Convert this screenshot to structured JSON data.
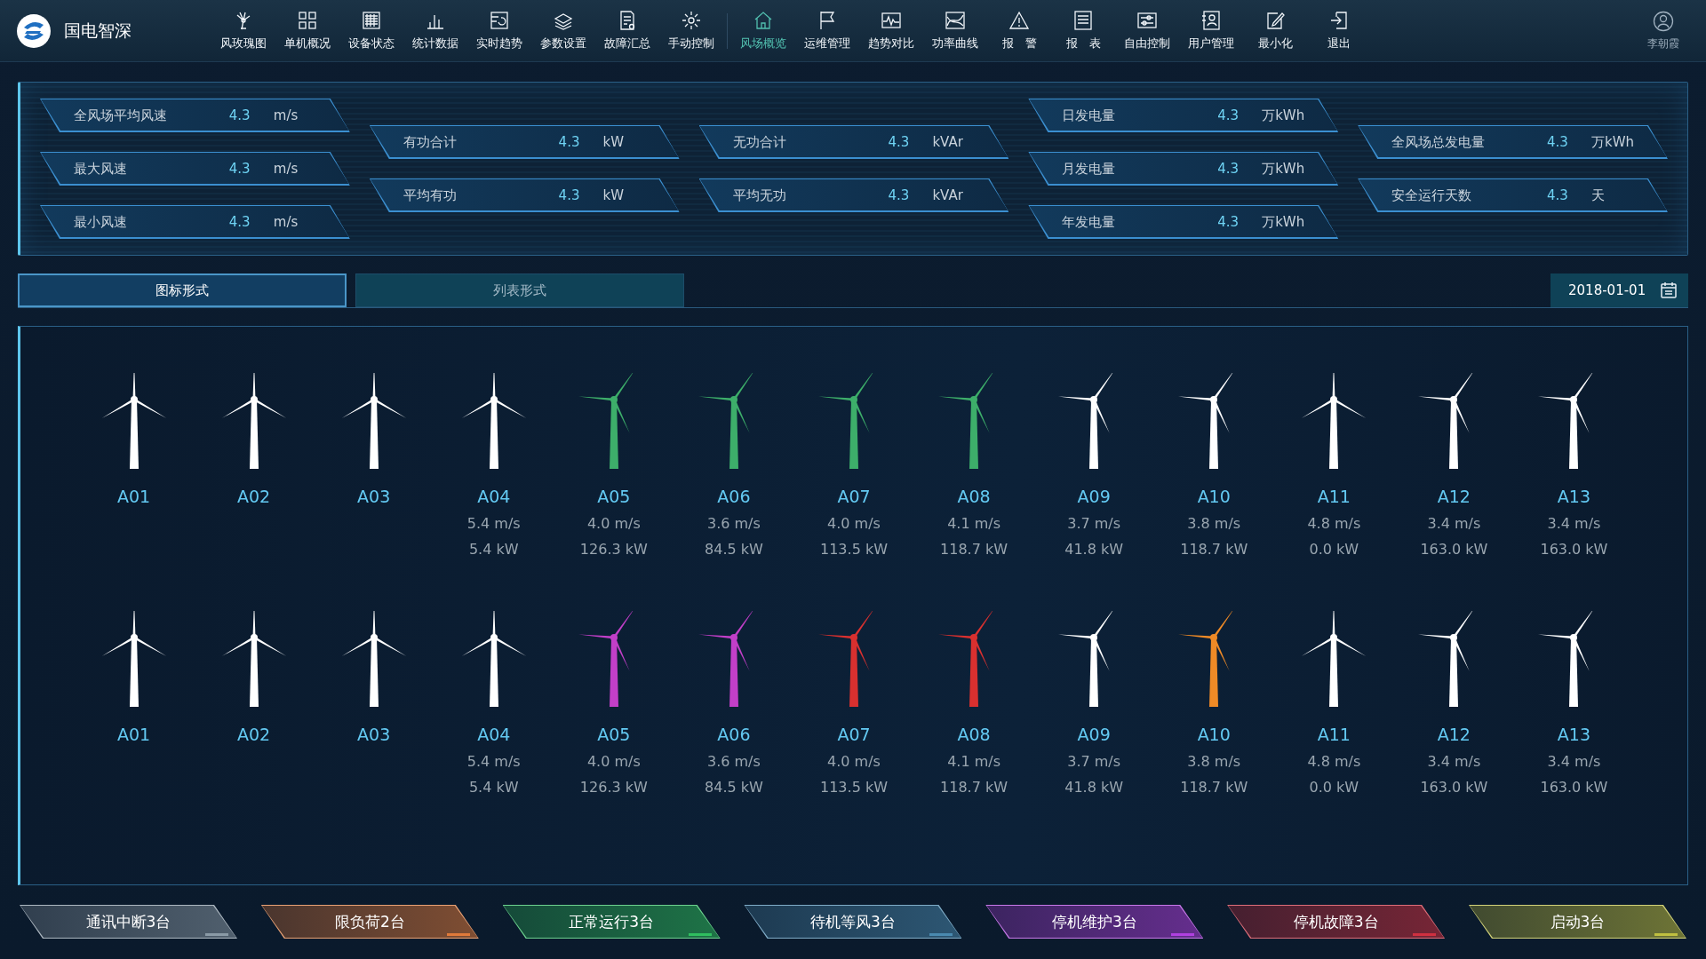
{
  "app": {
    "title": "国电智深",
    "user": "李朝霞"
  },
  "nav": [
    {
      "label": "风玫瑰图",
      "selected": false
    },
    {
      "label": "单机概况",
      "selected": false
    },
    {
      "label": "设备状态",
      "selected": false
    },
    {
      "label": "统计数据",
      "selected": false
    },
    {
      "label": "实时趋势",
      "selected": false
    },
    {
      "label": "参数设置",
      "selected": false
    },
    {
      "label": "故障汇总",
      "selected": false
    },
    {
      "label": "手动控制",
      "selected": false
    },
    {
      "label": "风场概览",
      "selected": true
    },
    {
      "label": "运维管理",
      "selected": false
    },
    {
      "label": "趋势对比",
      "selected": false
    },
    {
      "label": "功率曲线",
      "selected": false
    },
    {
      "label": "报　警",
      "selected": false
    },
    {
      "label": "报　表",
      "selected": false
    },
    {
      "label": "自由控制",
      "selected": false
    },
    {
      "label": "用户管理",
      "selected": false
    },
    {
      "label": "最小化",
      "selected": false
    },
    {
      "label": "退出",
      "selected": false
    }
  ],
  "stats": [
    {
      "items": [
        {
          "label": "全风场平均风速",
          "value": "4.3",
          "unit": "m/s"
        },
        {
          "label": "最大风速",
          "value": "4.3",
          "unit": "m/s"
        },
        {
          "label": "最小风速",
          "value": "4.3",
          "unit": "m/s"
        }
      ]
    },
    {
      "items": [
        {
          "label": "有功合计",
          "value": "4.3",
          "unit": "kW"
        },
        {
          "label": "平均有功",
          "value": "4.3",
          "unit": "kW"
        }
      ]
    },
    {
      "items": [
        {
          "label": "无功合计",
          "value": "4.3",
          "unit": "kVAr"
        },
        {
          "label": "平均无功",
          "value": "4.3",
          "unit": "kVAr"
        }
      ]
    },
    {
      "items": [
        {
          "label": "日发电量",
          "value": "4.3",
          "unit": "万kWh"
        },
        {
          "label": "月发电量",
          "value": "4.3",
          "unit": "万kWh"
        },
        {
          "label": "年发电量",
          "value": "4.3",
          "unit": "万kWh"
        }
      ]
    },
    {
      "items": [
        {
          "label": "全风场总发电量",
          "value": "4.3",
          "unit": "万kWh"
        },
        {
          "label": "安全运行天数",
          "value": "4.3",
          "unit": "天"
        }
      ]
    }
  ],
  "view_tabs": [
    {
      "label": "图标形式",
      "selected": true
    },
    {
      "label": "列表形式",
      "selected": false
    }
  ],
  "date": "2018-01-01",
  "turbine_rows": [
    [
      {
        "name": "A01",
        "kind": "upright",
        "color": "#ffffff"
      },
      {
        "name": "A02",
        "kind": "upright",
        "color": "#ffffff"
      },
      {
        "name": "A03",
        "kind": "upright",
        "color": "#ffffff"
      },
      {
        "name": "A04",
        "kind": "upright",
        "color": "#ffffff",
        "speed": "5.4 m/s",
        "power": "5.4 kW"
      },
      {
        "name": "A05",
        "kind": "turned",
        "color": "#3dae6a",
        "speed": "4.0 m/s",
        "power": "126.3 kW"
      },
      {
        "name": "A06",
        "kind": "turned",
        "color": "#3dae6a",
        "speed": "3.6 m/s",
        "power": "84.5 kW"
      },
      {
        "name": "A07",
        "kind": "turned",
        "color": "#3dae6a",
        "speed": "4.0 m/s",
        "power": "113.5 kW"
      },
      {
        "name": "A08",
        "kind": "turned",
        "color": "#3dae6a",
        "speed": "4.1 m/s",
        "power": "118.7 kW"
      },
      {
        "name": "A09",
        "kind": "turned",
        "color": "#ffffff",
        "speed": "3.7 m/s",
        "power": "41.8 kW"
      },
      {
        "name": "A10",
        "kind": "turned",
        "color": "#ffffff",
        "speed": "3.8 m/s",
        "power": "118.7 kW"
      },
      {
        "name": "A11",
        "kind": "upright",
        "color": "#ffffff",
        "speed": "4.8 m/s",
        "power": "0.0 kW"
      },
      {
        "name": "A12",
        "kind": "turned",
        "color": "#ffffff",
        "speed": "3.4 m/s",
        "power": "163.0 kW"
      },
      {
        "name": "A13",
        "kind": "turned",
        "color": "#ffffff",
        "speed": "3.4 m/s",
        "power": "163.0 kW"
      }
    ],
    [
      {
        "name": "A01",
        "kind": "upright",
        "color": "#ffffff"
      },
      {
        "name": "A02",
        "kind": "upright",
        "color": "#ffffff"
      },
      {
        "name": "A03",
        "kind": "upright",
        "color": "#ffffff"
      },
      {
        "name": "A04",
        "kind": "upright",
        "color": "#ffffff",
        "speed": "5.4 m/s",
        "power": "5.4 kW"
      },
      {
        "name": "A05",
        "kind": "turned",
        "color": "#c23fc8",
        "speed": "4.0 m/s",
        "power": "126.3 kW"
      },
      {
        "name": "A06",
        "kind": "turned",
        "color": "#c23fc8",
        "speed": "3.6 m/s",
        "power": "84.5 kW"
      },
      {
        "name": "A07",
        "kind": "turned",
        "color": "#d9302f",
        "speed": "4.0 m/s",
        "power": "113.5 kW"
      },
      {
        "name": "A08",
        "kind": "turned",
        "color": "#d9302f",
        "speed": "4.1 m/s",
        "power": "118.7 kW"
      },
      {
        "name": "A09",
        "kind": "turned",
        "color": "#ffffff",
        "speed": "3.7 m/s",
        "power": "41.8 kW"
      },
      {
        "name": "A10",
        "kind": "turned",
        "color": "#ef8a26",
        "speed": "3.8 m/s",
        "power": "118.7 kW"
      },
      {
        "name": "A11",
        "kind": "upright",
        "color": "#ffffff",
        "speed": "4.8 m/s",
        "power": "0.0 kW"
      },
      {
        "name": "A12",
        "kind": "turned",
        "color": "#ffffff",
        "speed": "3.4 m/s",
        "power": "163.0 kW"
      },
      {
        "name": "A13",
        "kind": "turned",
        "color": "#ffffff",
        "speed": "3.4 m/s",
        "power": "163.0 kW"
      }
    ]
  ],
  "legend": [
    {
      "label": "通讯中断3台",
      "color": "#8a9aa6"
    },
    {
      "label": "限负荷2台",
      "color": "#e07a3a"
    },
    {
      "label": "正常运行3台",
      "color": "#2fbf5f"
    },
    {
      "label": "待机等风3台",
      "color": "#4a8ab0"
    },
    {
      "label": "停机维护3台",
      "color": "#b040e0"
    },
    {
      "label": "停机故障3台",
      "color": "#d03040"
    },
    {
      "label": "启动3台",
      "color": "#c0c040"
    }
  ]
}
